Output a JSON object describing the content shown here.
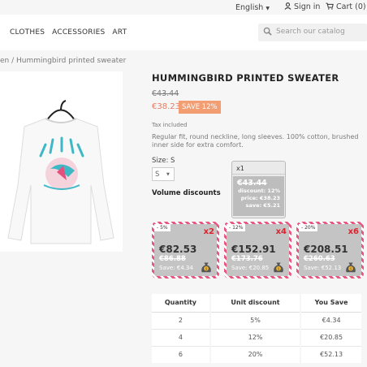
{
  "header": {
    "language": "English",
    "signin": "Sign in",
    "cart": "Cart (0)"
  },
  "nav": {
    "items": [
      "CLOTHES",
      "ACCESSORIES",
      "ART"
    ],
    "search_placeholder": "Search our catalog"
  },
  "breadcrumb": "en / Hummingbird printed sweater",
  "product": {
    "title": "HUMMINGBIRD PRINTED SWEATER",
    "regular_price": "€43.44",
    "price": "€38.23",
    "save_badge": "SAVE 12%",
    "tax": "Tax included",
    "description": "Regular fit, round neckline, long sleeves. 100% cotton, brushed inner side for extra comfort.",
    "size_label": "Size: S",
    "size_value": "S",
    "volume_title": "Volume discounts"
  },
  "tooltip": {
    "qty": "x1",
    "old_price": "€43.44",
    "discount": "discount: 12%",
    "price": "price: €38.23",
    "save": "save: €5.21"
  },
  "volume_cards": [
    {
      "pct": "- 5%",
      "mult": "x2",
      "amount": "€82.53",
      "old": "€86.88",
      "save": "Save: €4.34"
    },
    {
      "pct": "- 12%",
      "mult": "x4",
      "amount": "€152.91",
      "old": "€173.76",
      "save": "Save: €20.85"
    },
    {
      "pct": "- 20%",
      "mult": "x6",
      "amount": "€208.51",
      "old": "€260.63",
      "save": "Save: €52.13"
    }
  ],
  "discount_table": {
    "headers": [
      "Quantity",
      "Unit discount",
      "You Save"
    ],
    "rows": [
      [
        "2",
        "5%",
        "€4.34"
      ],
      [
        "4",
        "12%",
        "€20.85"
      ],
      [
        "6",
        "20%",
        "€52.13"
      ]
    ]
  },
  "colors": {
    "accent": "#f39d72",
    "price": "#e57c62",
    "stripe": "#e8557f",
    "multiplier": "#d9242e"
  }
}
